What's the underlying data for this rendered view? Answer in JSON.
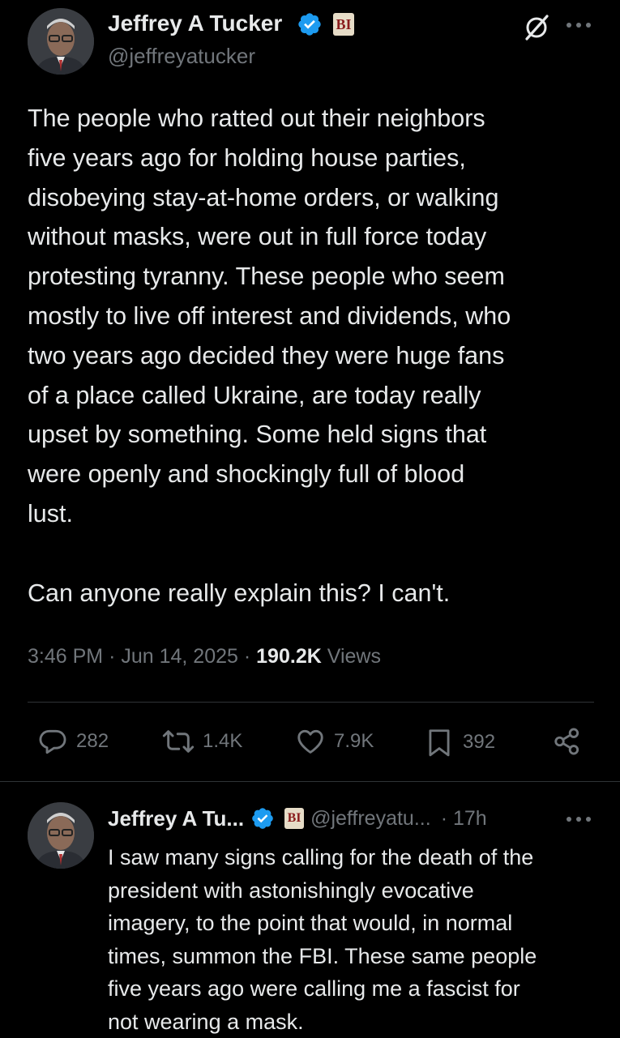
{
  "main_tweet": {
    "author": {
      "name": "Jeffrey A Tucker",
      "handle": "@jeffreyatucker",
      "affiliation_badge": "BI",
      "verified": true
    },
    "text": "The people who ratted out their neighbors\nfive years ago for holding house parties,\ndisobeying stay-at-home orders, or walking\nwithout masks, were out in full force today\nprotesting tyranny. These people who seem\nmostly to live off interest and dividends, who\ntwo years ago decided they were huge fans\nof a place called Ukraine, are today really\nupset by something. Some held signs that\nwere openly and shockingly full of blood\nlust.\n\nCan anyone really explain this? I can't.",
    "time": "3:46 PM",
    "date": "Jun 14, 2025",
    "views_count": "190.2K",
    "views_label": "Views",
    "meta_separator": "·",
    "actions": {
      "replies": "282",
      "reposts": "1.4K",
      "likes": "7.9K",
      "bookmarks": "392"
    }
  },
  "reply_tweet": {
    "author": {
      "name": "Jeffrey A Tu...",
      "handle": "@jeffreyatu...",
      "affiliation_badge": "BI",
      "verified": true
    },
    "time_ago": "· 17h",
    "text": "I saw many signs calling for the death of the\npresident with astonishingly evocative\nimagery, to the point that would, in normal\ntimes, summon the FBI. These same people\nfive years ago were calling me a fascist for\nnot wearing a mask."
  },
  "icons": [
    "grok-icon",
    "more-icon",
    "reply-icon",
    "repost-icon",
    "like-icon",
    "bookmark-icon",
    "share-icon",
    "verified-icon"
  ],
  "colors": {
    "background": "#000000",
    "text_primary": "#e7e9ea",
    "text_secondary": "#71767b",
    "verified_blue": "#1d9bf0",
    "divider": "#2f3336"
  }
}
